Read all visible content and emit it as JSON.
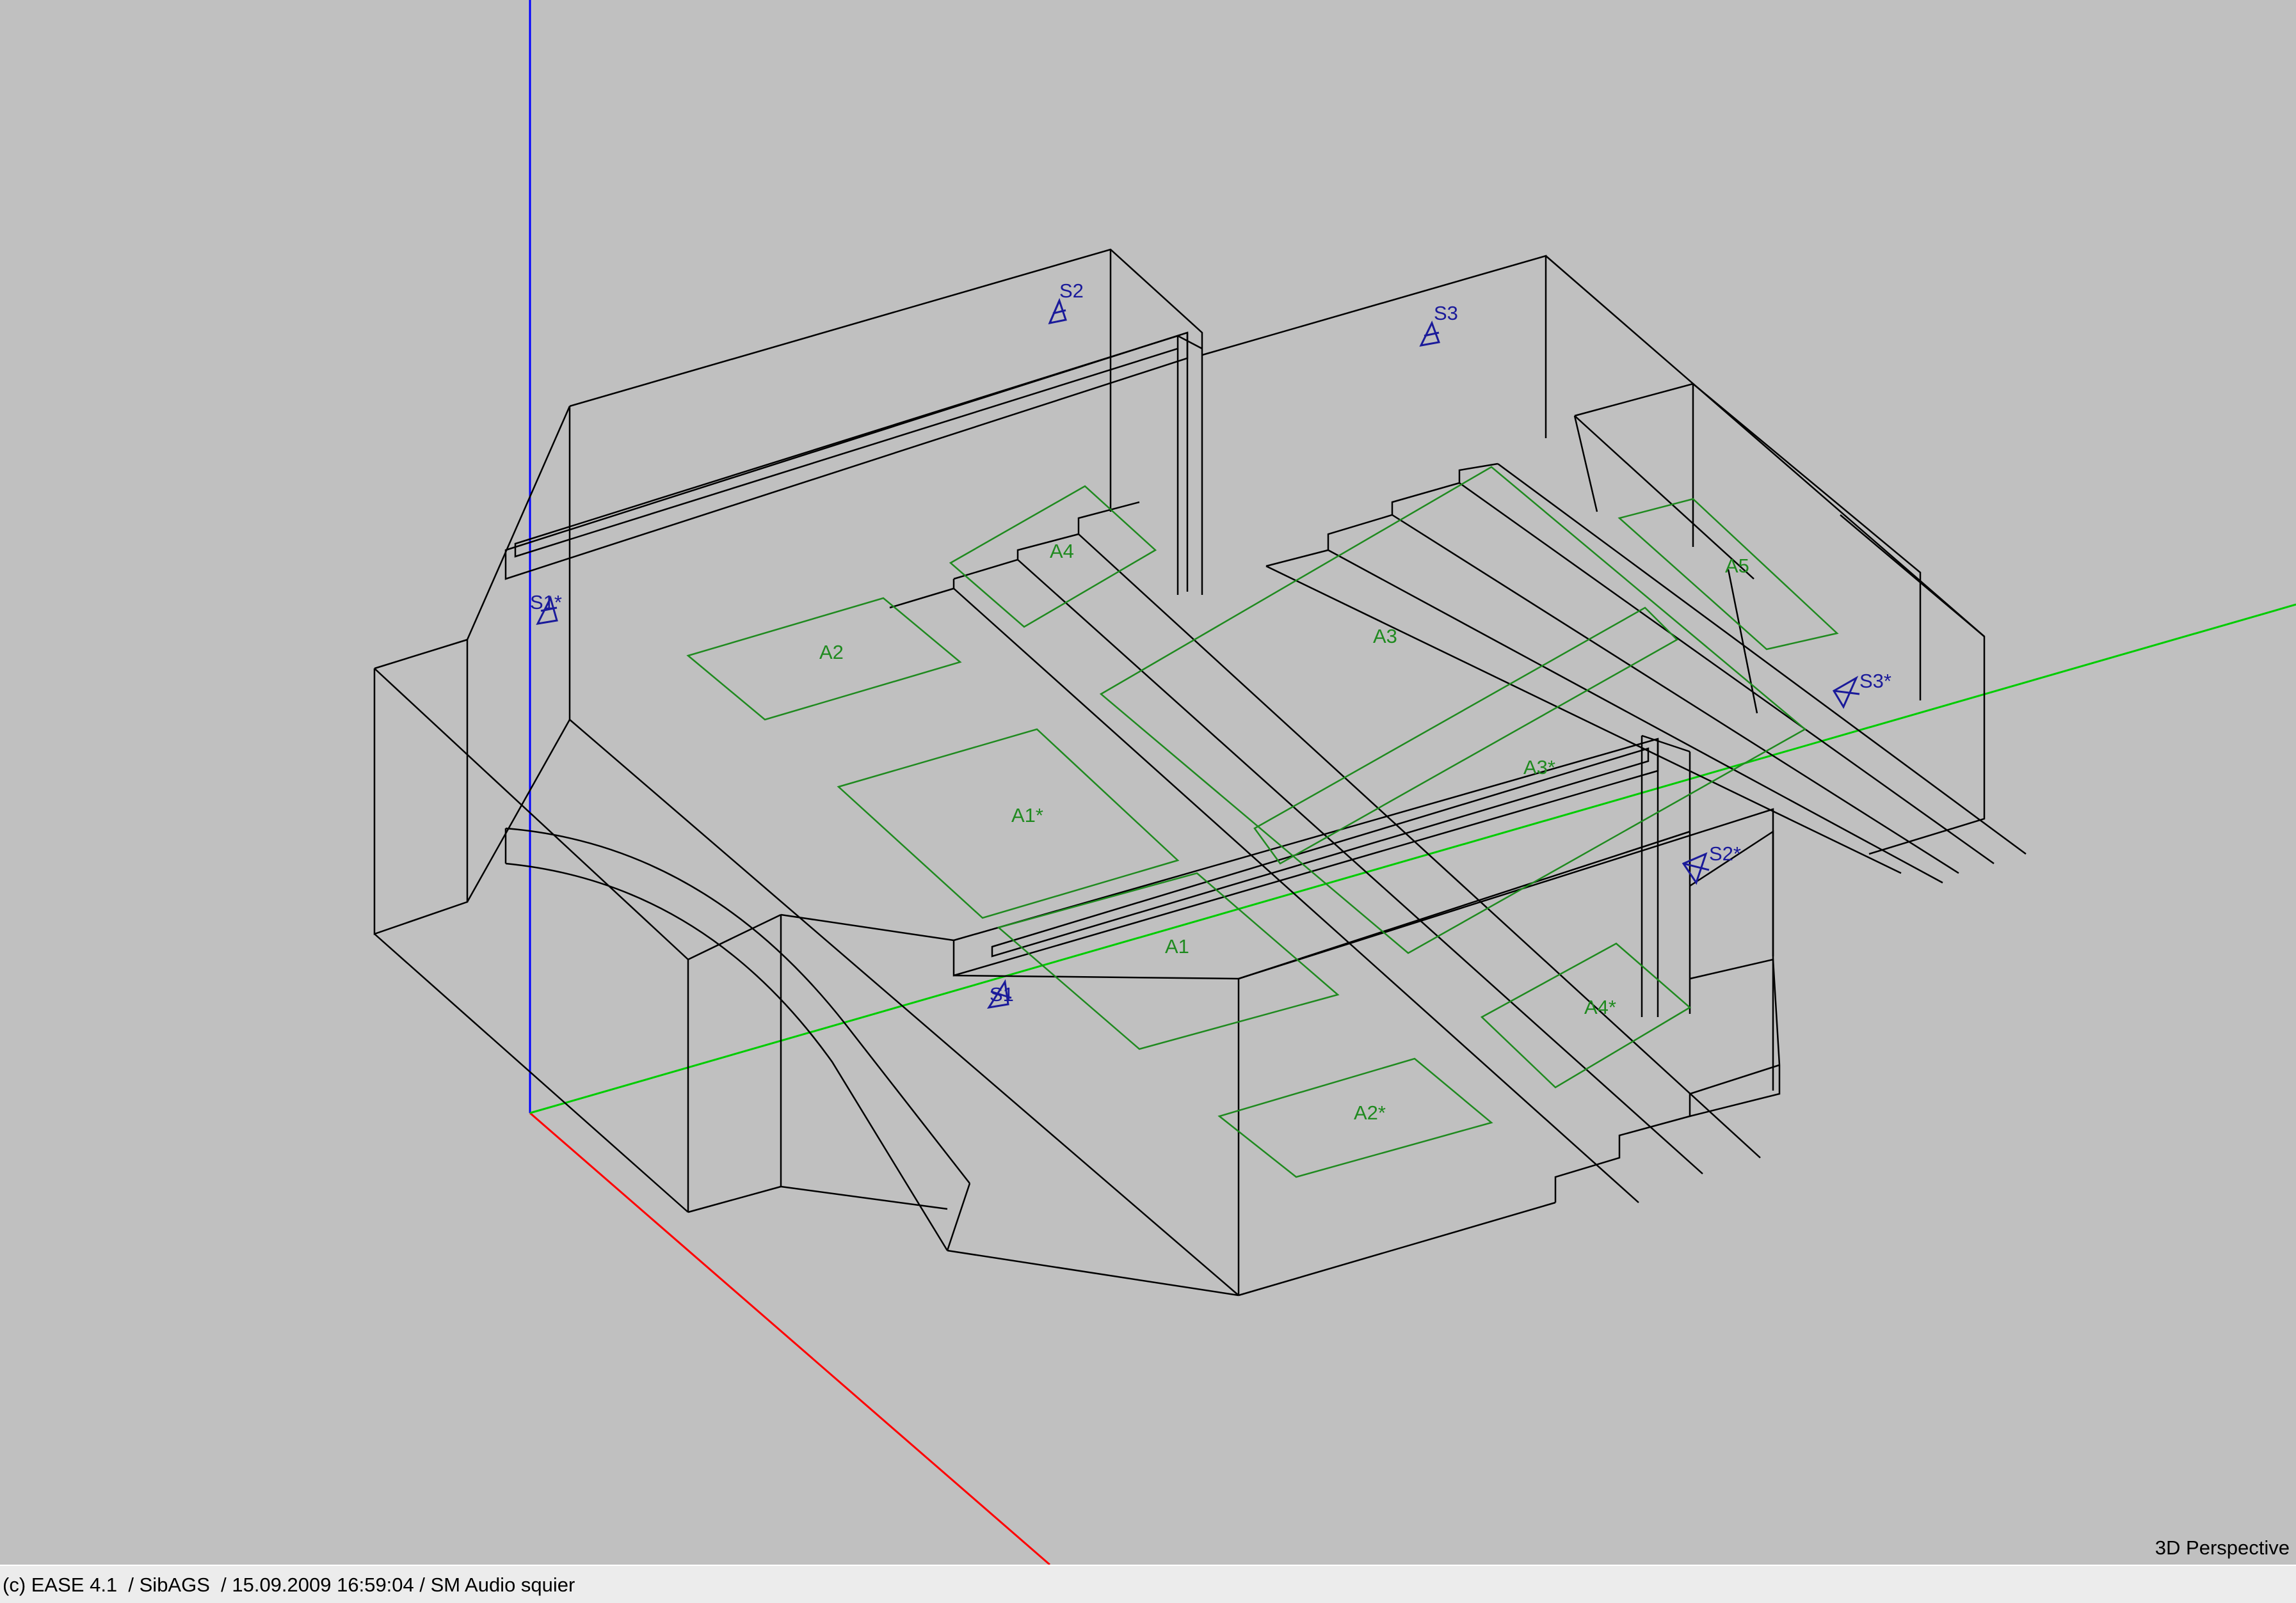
{
  "viewport": {
    "view_mode": "3D Perspective",
    "axis_colors": {
      "x": "#ff0000",
      "y": "#00cc00",
      "z": "#0000ff"
    },
    "wire_color": "#000000",
    "area_color": "#1f8a1f",
    "speaker_color": "#1a1a9a",
    "areas": [
      {
        "id": "A1",
        "label": "A1"
      },
      {
        "id": "A1x",
        "label": "A1*"
      },
      {
        "id": "A2",
        "label": "A2"
      },
      {
        "id": "A2x",
        "label": "A2*"
      },
      {
        "id": "A3",
        "label": "A3"
      },
      {
        "id": "A3x",
        "label": "A3*"
      },
      {
        "id": "A4",
        "label": "A4"
      },
      {
        "id": "A4x",
        "label": "A4*"
      },
      {
        "id": "A5",
        "label": "A5"
      }
    ],
    "speakers": [
      {
        "id": "S1",
        "label": "S1"
      },
      {
        "id": "S1x",
        "label": "S1*"
      },
      {
        "id": "S2",
        "label": "S2"
      },
      {
        "id": "S2x",
        "label": "S2*"
      },
      {
        "id": "S3",
        "label": "S3"
      },
      {
        "id": "S3x",
        "label": "S3*"
      }
    ]
  },
  "status_bar": {
    "text": "(c) EASE 4.1  / SibAGS  / 15.09.2009 16:59:04 / SM Audio squier"
  }
}
